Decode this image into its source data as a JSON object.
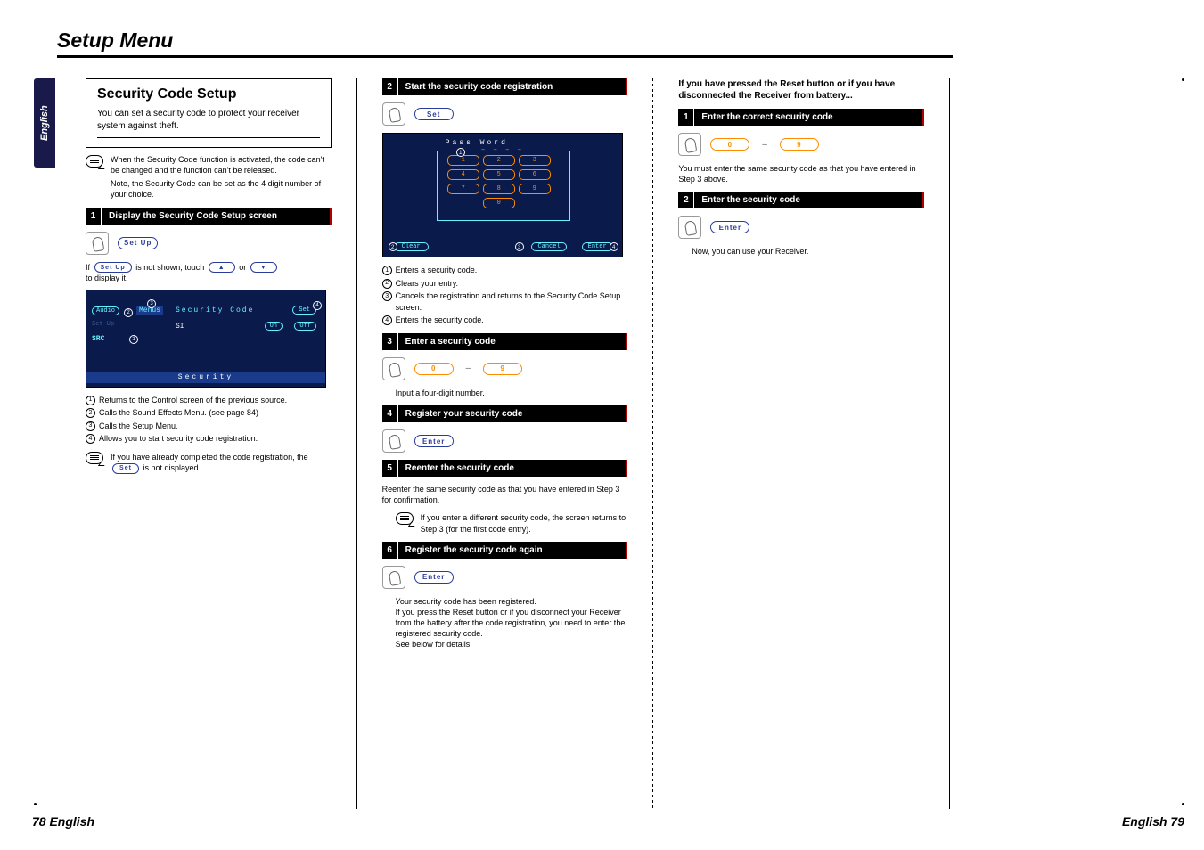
{
  "page": {
    "title": "Setup Menu",
    "footer_left": "78 English",
    "footer_right": "English 79",
    "side_tab": "English"
  },
  "col1": {
    "section_title": "Security Code Setup",
    "intro": "You can set a security code to protect your receiver system against theft.",
    "note1": "When the Security Code function is activated, the code can't be changed and the function can't be released.",
    "note2": "Note, the Security Code can be set as the 4 digit number of your choice.",
    "step1": {
      "num": "1",
      "label": "Display the Security Code Setup screen"
    },
    "setup_pill": "Set Up",
    "if_text_a": "If ",
    "if_text_b": " is not shown, touch ",
    "if_text_c": " or ",
    "if_text_d": " to display it.",
    "arrow_up": "▲",
    "arrow_down": "▼",
    "screen1": {
      "audio": "Audio",
      "setup": "Set Up",
      "src": "SRC",
      "menus": "Menus",
      "title": "Security Code",
      "set": "Set",
      "si": "SI",
      "on": "On",
      "off": "Off",
      "security": "Security"
    },
    "list": {
      "i1": "Returns to the Control screen of the previous source.",
      "i2": "Calls the Sound Effects Menu. (see page 84)",
      "i3": "Calls the Setup Menu.",
      "i4": "Allows you to start security code registration."
    },
    "note3_a": "If you have already completed the code registration, the ",
    "note3_pill": "Set",
    "note3_b": " is not displayed."
  },
  "col2": {
    "step2": {
      "num": "2",
      "label": "Start the security code registration"
    },
    "set_pill": "Set",
    "screen2": {
      "title": "Pass Word",
      "dashes": "– – – –",
      "k1": "1",
      "k2": "2",
      "k3": "3",
      "k4": "4",
      "k5": "5",
      "k6": "6",
      "k7": "7",
      "k8": "8",
      "k9": "9",
      "k0": "0",
      "clear": "Clear",
      "cancel": "Cancel",
      "enter": "Enter"
    },
    "list2": {
      "i1": "Enters a security code.",
      "i2": "Clears your entry.",
      "i3": "Cancels the registration and returns to the Security Code Setup screen.",
      "i4": "Enters the security code."
    },
    "step3": {
      "num": "3",
      "label": "Enter a security code"
    },
    "digit0": "0",
    "digit9": "9",
    "input_text": "Input a four-digit number.",
    "step4": {
      "num": "4",
      "label": "Register your security code"
    },
    "enter_pill": "Enter",
    "step5": {
      "num": "5",
      "label": "Reenter the security code"
    },
    "reenter_text": "Reenter the same security code as that you have entered in Step 3 for confirmation.",
    "note4": "If you enter a different security code, the screen returns to Step 3 (for the first code entry).",
    "step6": {
      "num": "6",
      "label": "Register the security code again"
    },
    "final1": "Your security code has been registered.",
    "final2": "If you press the Reset button or if you disconnect your Receiver from the battery after the code registration, you need to enter the registered security code.",
    "final3": "See below for details."
  },
  "col3": {
    "heading": "If you have pressed the Reset button or if you have disconnected the Receiver from battery...",
    "step1": {
      "num": "1",
      "label": "Enter the correct security code"
    },
    "digit0": "0",
    "digit9": "9",
    "text1": "You must enter the same security code as that you have entered in Step 3 above.",
    "step2": {
      "num": "2",
      "label": "Enter the security code"
    },
    "enter_pill": "Enter",
    "text2": "Now, you can use your Receiver."
  }
}
